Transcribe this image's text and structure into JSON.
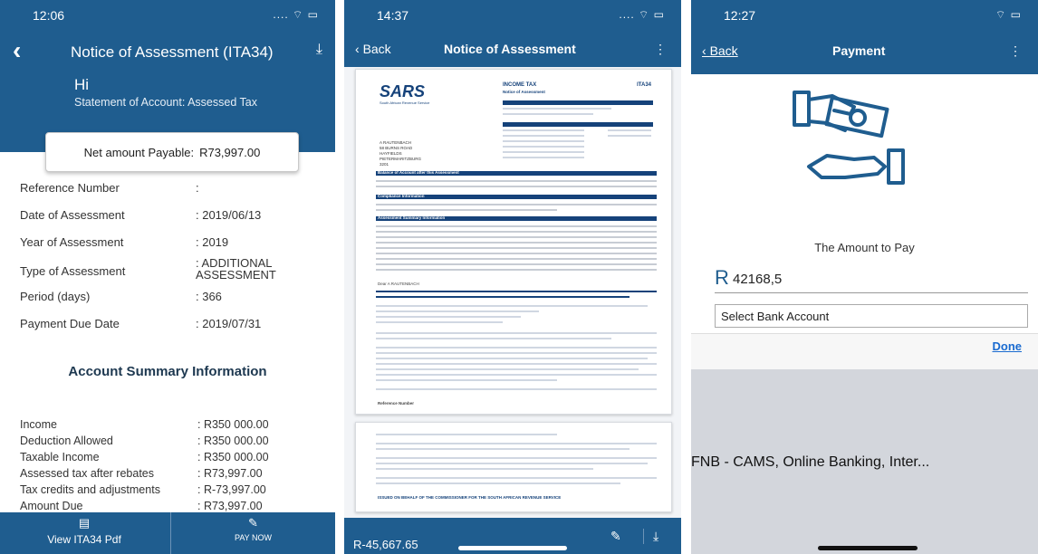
{
  "colors": {
    "primary": "#1f5d8f",
    "accent_link": "#1a6bd0",
    "text": "#333333"
  },
  "phone1": {
    "status": {
      "time": "12:06"
    },
    "nav": {
      "back_icon": "chevron-left-icon",
      "title": "Notice of Assessment (ITA34)",
      "download_icon": "download-icon"
    },
    "greeting": "Hi",
    "statement": "Statement of Account: Assessed Tax",
    "net": {
      "label": "Net amount Payable:",
      "value": "R73,997.00"
    },
    "details": [
      {
        "label": "Reference Number",
        "value": ":"
      },
      {
        "label": "Date of Assessment",
        "value": ": 2019/06/13"
      },
      {
        "label": "Year of Assessment",
        "value": ": 2019"
      },
      {
        "label": "Type of Assessment",
        "value": ": ADDITIONAL ASSESSMENT"
      },
      {
        "label": "Period (days)",
        "value": ": 366"
      },
      {
        "label": "Payment Due Date",
        "value": ": 2019/07/31"
      }
    ],
    "summary_title": "Account Summary Information",
    "summary": [
      {
        "label": "Income",
        "value": ": R350 000.00"
      },
      {
        "label": "Deduction Allowed",
        "value": ": R350 000.00"
      },
      {
        "label": "Taxable Income",
        "value": ": R350 000.00"
      },
      {
        "label": "Assessed tax after rebates",
        "value": ": R73,997.00"
      },
      {
        "label": "Tax credits and adjustments",
        "value": ": R-73,997.00"
      },
      {
        "label": "Amount Due",
        "value": ": R73,997.00"
      }
    ],
    "bottom": {
      "left_label": "View ITA34 Pdf",
      "left_icon": "pdf-file-icon",
      "right_label": "PAY NOW",
      "right_icon": "pay-cash-icon"
    }
  },
  "phone2": {
    "status": {
      "time": "14:37"
    },
    "nav": {
      "back": "Back",
      "title": "Notice of Assessment",
      "more": "⋮"
    },
    "doc": {
      "logo": "SARS",
      "logo_sub": "South African Revenue Service",
      "header_left": "INCOME TAX",
      "header_sub": "Notice of Assessment",
      "header_right": "ITA34",
      "address": "A RAUTENBACH\n58 BURNS ROAD\nHAYFIELDS\nPIETERMARITZBURG\n3201",
      "sec_balance": "Balance of Account after this Assessment",
      "sec_compliance": "Compliance Information",
      "sec_summary": "Assessment Summary Information",
      "dear": "Dear A RAUTENBACH",
      "ref_label": "Reference Number",
      "footer_line": "ISSUED ON BEHALF OF THE COMMISSIONER FOR THE SOUTH AFRICAN REVENUE SERVICE"
    },
    "bottom": {
      "amount": "R-45,667.65",
      "pay_icon": "pay-cash-icon",
      "share_icon": "download-icon"
    }
  },
  "phone3": {
    "status": {
      "time": "12:27"
    },
    "nav": {
      "back": "Back",
      "title": "Payment",
      "more": "⋮"
    },
    "illustration_icon": "hand-payment-icon",
    "amount_label": "The Amount to Pay",
    "currency": "R",
    "amount": "42168,5",
    "bank_placeholder": "Select Bank Account",
    "done": "Done",
    "picker_item": "FNB - CAMS, Online Banking, Inter..."
  }
}
